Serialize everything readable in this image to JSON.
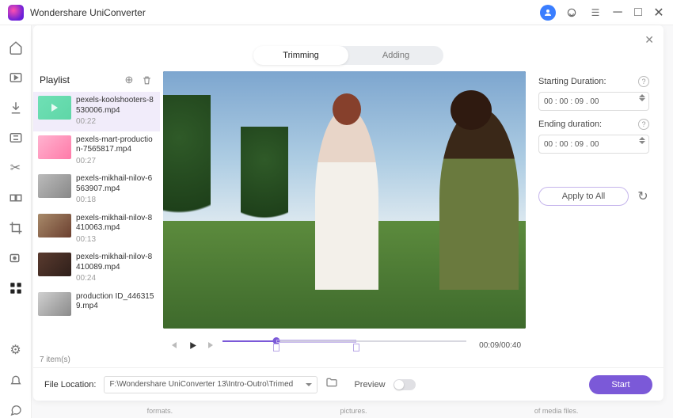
{
  "app": {
    "title": "Wondershare UniConverter"
  },
  "tabs": {
    "trimming": "Trimming",
    "adding": "Adding"
  },
  "playlist": {
    "title": "Playlist",
    "items": [
      {
        "name": "pexels-koolshooters-8530006.mp4",
        "dur": "00:22"
      },
      {
        "name": "pexels-mart-production-7565817.mp4",
        "dur": "00:27"
      },
      {
        "name": "pexels-mikhail-nilov-6563907.mp4",
        "dur": "00:18"
      },
      {
        "name": "pexels-mikhail-nilov-8410063.mp4",
        "dur": "00:13"
      },
      {
        "name": "pexels-mikhail-nilov-8410089.mp4",
        "dur": "00:24"
      },
      {
        "name": "production ID_4463159.mp4",
        "dur": ""
      }
    ],
    "count_label": "7 item(s)"
  },
  "player": {
    "time": "00:09/00:40"
  },
  "settings": {
    "start_label": "Starting Duration:",
    "start_value": "00 : 00 : 09 . 00",
    "end_label": "Ending duration:",
    "end_value": "00 : 00 : 09 . 00",
    "apply_all": "Apply to All"
  },
  "footer": {
    "file_loc_label": "File Location:",
    "file_loc_value": "F:\\Wondershare UniConverter 13\\Intro-Outro\\Trimed",
    "preview_label": "Preview",
    "start": "Start"
  },
  "bg": {
    "h1": "formats.",
    "h2": "pictures.",
    "h3": "of media files."
  }
}
